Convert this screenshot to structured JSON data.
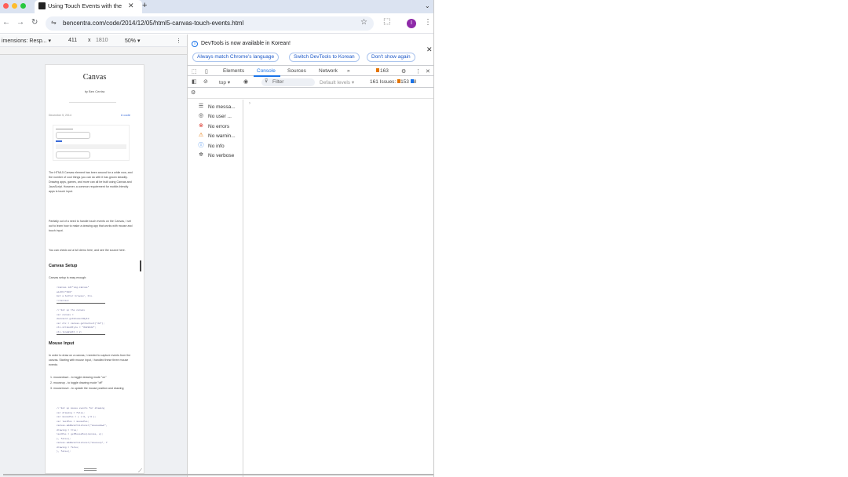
{
  "tab": {
    "title": "Using Touch Events with the"
  },
  "url": "bencentra.com/code/2014/12/05/html5-canvas-touch-events.html",
  "device_toolbar": {
    "dimensions": "imensions: Resp...",
    "width": "411",
    "x": "x",
    "height": "1810",
    "zoom": "50%"
  },
  "page": {
    "title": "Canvas",
    "byline": "by Ben Centra",
    "date": "December 5, 2014",
    "code_link": "# code",
    "intro": "The HTML5 Canvas element has been around for a while now, and the number of cool things you can do with it has grown steadily. Drawing apps, games, and more can all be built using Canvas and JavaScript. However, a common requirement for mobile-friendly apps is touch input.",
    "para2": "Partially out of a need to handle touch events on the Canvas, I set out to learn how to make a drawing app that works with mouse and touch input.",
    "para3": "You can check out a full demo here, and see the source here.",
    "section1": "Canvas Setup",
    "section1_text": "Canvas setup is easy enough:",
    "code1": [
      "<canvas id=\"sig-canvas\" width=\"620\"",
      "  Get a better browser, bro.",
      "</canvas>"
    ],
    "code2": [
      "// Set up the canvas",
      "var canvas = document.getElementById",
      "var ctx = canvas.getContext(\"2d\");",
      "ctx.strokeStyle = \"#222222\";",
      "ctx.lineWidth = 2;"
    ],
    "section2": "Mouse Input",
    "section2_text": "In order to draw on a canvas, I needed to capture events from the canvas. Starting with mouse input, I handled these three mouse events:",
    "list": [
      "1. mousedown - to toggle drawing mode \"on\"",
      "2. mouseup - to toggle drawing mode \"off\"",
      "3. mousemove - to update the mouse position and drawing"
    ],
    "code3": [
      "// Set up mouse events for drawing",
      "var drawing = false;",
      "var mousePos = { x:0, y:0 };",
      "var lastPos = mousePos;",
      "canvas.addEventListener(\"mousedown\",",
      "  drawing = true;",
      "  lastPos = getMousePos(canvas, e);",
      "}, false);",
      "canvas.addEventListener(\"mouseup\", f",
      "  drawing = false;",
      "}, false);"
    ]
  },
  "devtools": {
    "notice": "DevTools is now available in Korean!",
    "pill1": "Always match Chrome's language",
    "pill2": "Switch DevTools to Korean",
    "pill3": "Don't show again",
    "tabs": [
      "Elements",
      "Console",
      "Sources",
      "Network"
    ],
    "more": "»",
    "issue_count_badge": "163",
    "context": "top",
    "filter_placeholder": "Filter",
    "levels": "Default levels",
    "issues_text": "161 Issues:",
    "issues_a": "153",
    "issues_b": "8",
    "sidebar": [
      {
        "label": "No messa...",
        "icon": "list-icon"
      },
      {
        "label": "No user ...",
        "icon": "user-icon"
      },
      {
        "label": "No errors",
        "icon": "error-icon"
      },
      {
        "label": "No warnin...",
        "icon": "warning-icon"
      },
      {
        "label": "No info",
        "icon": "info-icon"
      },
      {
        "label": "No verbose",
        "icon": "bug-icon"
      }
    ]
  }
}
